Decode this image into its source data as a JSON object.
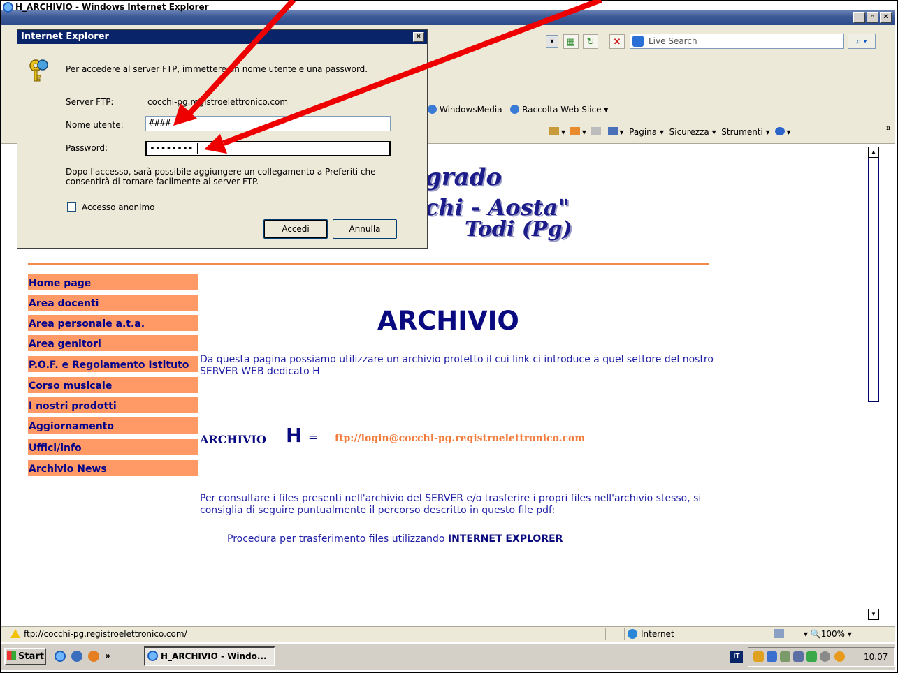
{
  "window": {
    "title": "H_ARCHIVIO - Windows Internet Explorer",
    "min": "_",
    "max": "▫",
    "close": "×"
  },
  "toolbar": {
    "search_placeholder": "Live Search",
    "search_btn": "⌕ ▾",
    "addr_dropdown": "▼",
    "refresh": "↻",
    "stop": "✕",
    "fav_links": [
      "WindowsMedia",
      "Raccolta Web Slice ▾"
    ],
    "cmd": [
      "Pagina ▾",
      "Sicurezza ▾",
      "Strumenti ▾"
    ],
    "chevron": "»"
  },
  "banner": {
    "line1": "grado",
    "line2": "chi - Aosta\"",
    "line3": "Todi (Pg)"
  },
  "menu": [
    "Home page",
    "Area docenti",
    "Area personale a.t.a.",
    "Area genitori",
    "P.O.F. e Regolamento Istituto",
    "Corso musicale",
    "I nostri prodotti",
    "Aggiornamento",
    "Uffici/info",
    "Archivio News"
  ],
  "content": {
    "heading": "ARCHIVIO",
    "intro": "Da questa pagina possiamo utilizzare un archivio protetto il cui link ci introduce a quel settore del nostro SERVER WEB dedicato H",
    "archive_label": "ARCHIVIO",
    "archive_letter": "H",
    "archive_eq": "=",
    "ftp_link": "ftp://login@cocchi-pg.registroelettronico.com",
    "consult": "Per consultare i files presenti nell'archivio del SERVER e/o trasferire i propri files nell'archivio stesso, si consiglia di seguire puntualmente il percorso descritto in questo file pdf:",
    "procedure": "Procedura per trasferimento files utilizzando ",
    "procedure_strong": "INTERNET EXPLORER"
  },
  "scroll": {
    "up": "▲",
    "down": "▼"
  },
  "statusbar": {
    "url": "ftp://cocchi-pg.registroelettronico.com/",
    "zone": "Internet",
    "zoom": "▾   🔍100%  ▾"
  },
  "taskbar": {
    "start": "Start",
    "chevron": "»",
    "task": "H_ARCHIVIO - Windo...",
    "lang": "IT",
    "clock": "10.07"
  },
  "dialog": {
    "title": "Internet Explorer",
    "close": "×",
    "message": "Per accedere al server FTP, immettere un nome utente e una password.",
    "server_label": "Server FTP:",
    "server_value": "cocchi-pg.registroelettronico.com",
    "user_label": "Nome utente:",
    "user_value": "####",
    "pass_label": "Password:",
    "pass_value": "••••••••",
    "note": "Dopo l'accesso, sarà possibile aggiungere un collegamento a Preferiti che consentirà di tornare facilmente al server FTP.",
    "anon_label": "Accesso anonimo",
    "anon_checked": false,
    "btn_login": "Accedi",
    "btn_cancel": "Annulla"
  },
  "colors": {
    "menu_bg": "#ff9966",
    "menu_text": "#00008b",
    "heading": "#0a0a80",
    "link": "#f07b3a",
    "arrow": "#ee0000"
  }
}
